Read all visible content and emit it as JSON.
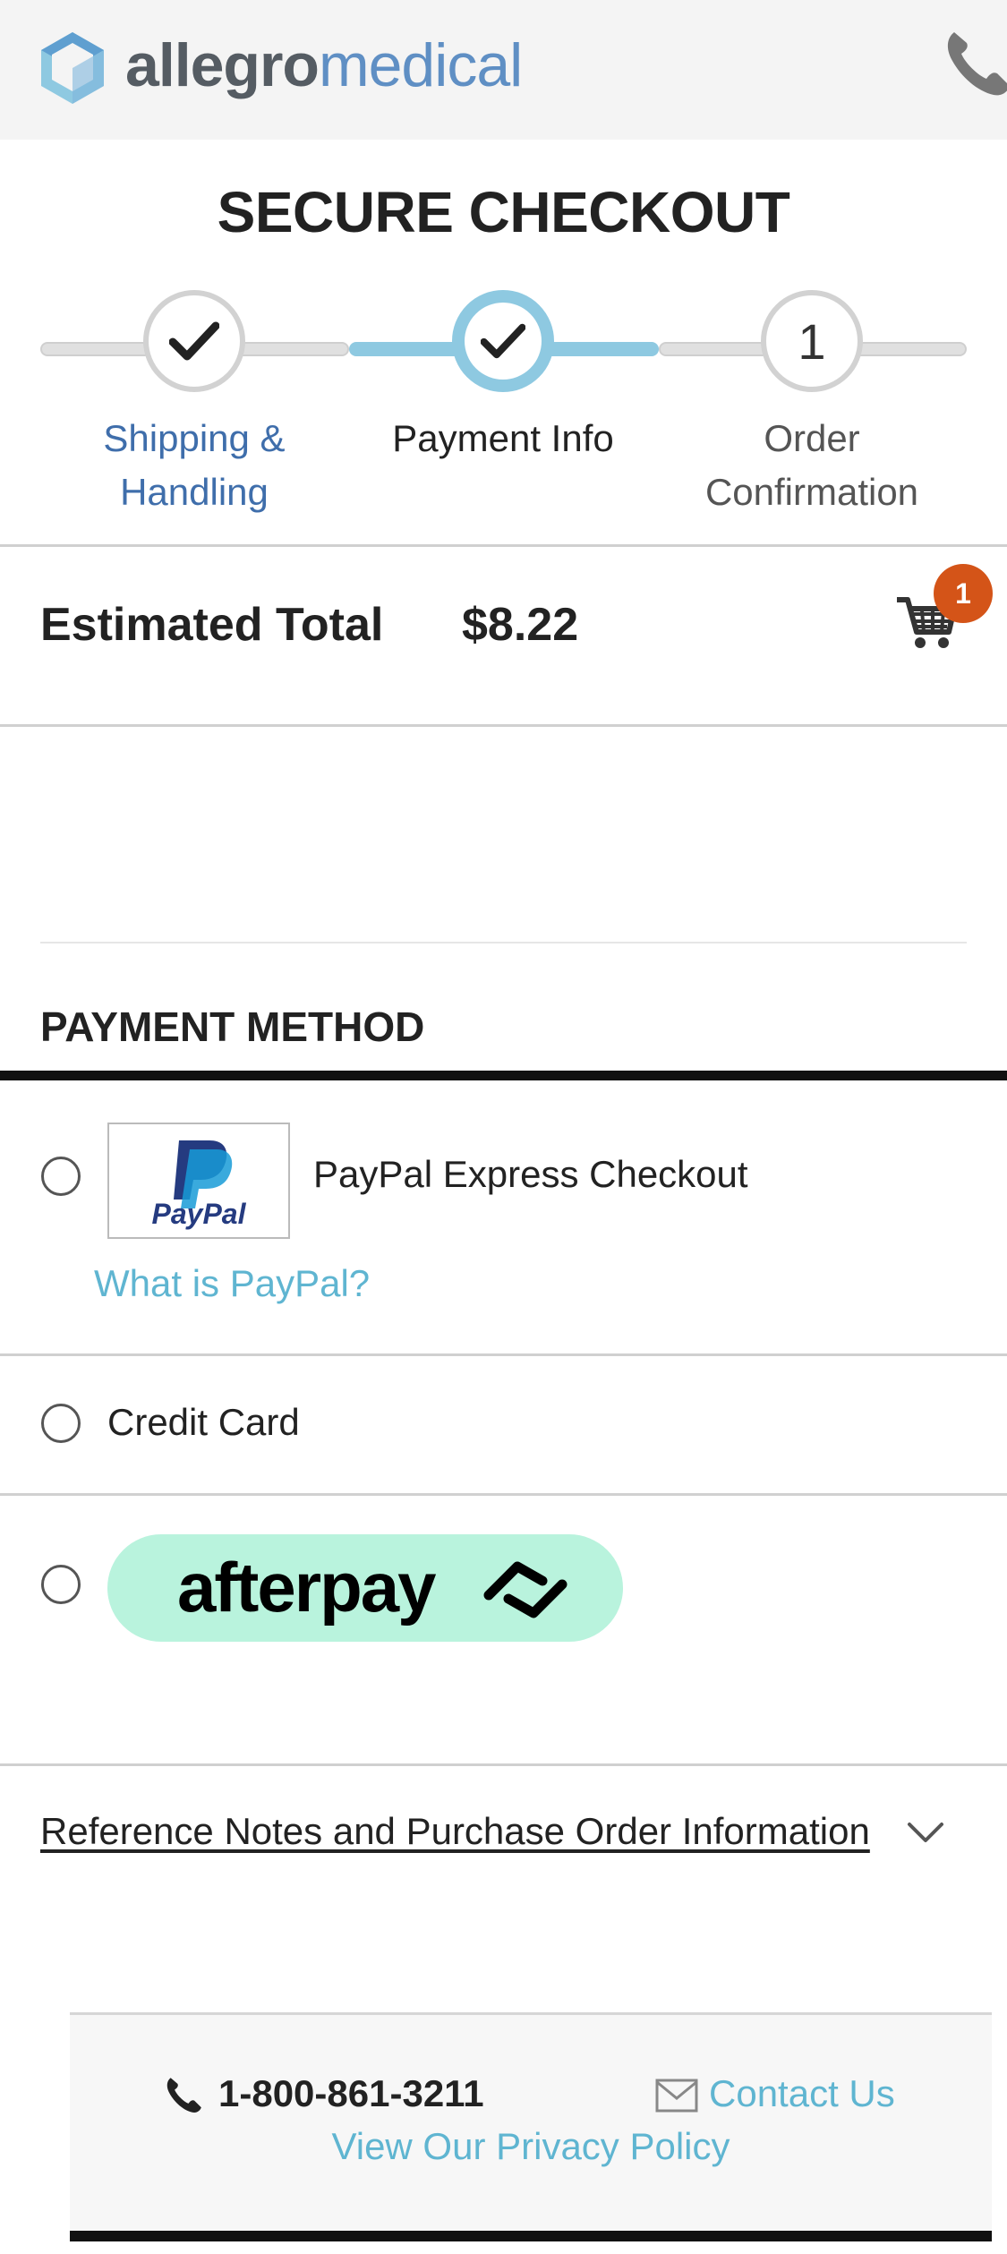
{
  "header": {
    "logo_primary": "allegro",
    "logo_secondary": "medical",
    "phone_icon": "phone-icon"
  },
  "title": "SECURE CHECKOUT",
  "stepper": {
    "steps": [
      {
        "label": "Shipping & Handling",
        "state": "complete"
      },
      {
        "label": "Payment Info",
        "state": "current"
      },
      {
        "label": "Order Confirmation",
        "state": "pending",
        "number": "1"
      }
    ]
  },
  "summary": {
    "estimated_total_label": "Estimated Total",
    "estimated_total_value": "$8.22",
    "cart_count": "1"
  },
  "payment": {
    "heading": "PAYMENT METHOD",
    "options": [
      {
        "label": "PayPal Express Checkout",
        "logo_text": "PayPal",
        "help_link": "What is PayPal?"
      },
      {
        "label": "Credit Card"
      },
      {
        "logo_text": "afterpay"
      }
    ]
  },
  "reference_notes": "Reference Notes and Purchase Order Information",
  "footer": {
    "phone": "1-800-861-3211",
    "contact": "Contact Us",
    "privacy": "View Our Privacy Policy"
  },
  "colors": {
    "brand_blue": "#5f8fc4",
    "link": "#5fb5d1",
    "step_active": "#8ec9e1",
    "badge": "#d45418",
    "afterpay_bg": "#b9f3dd"
  }
}
